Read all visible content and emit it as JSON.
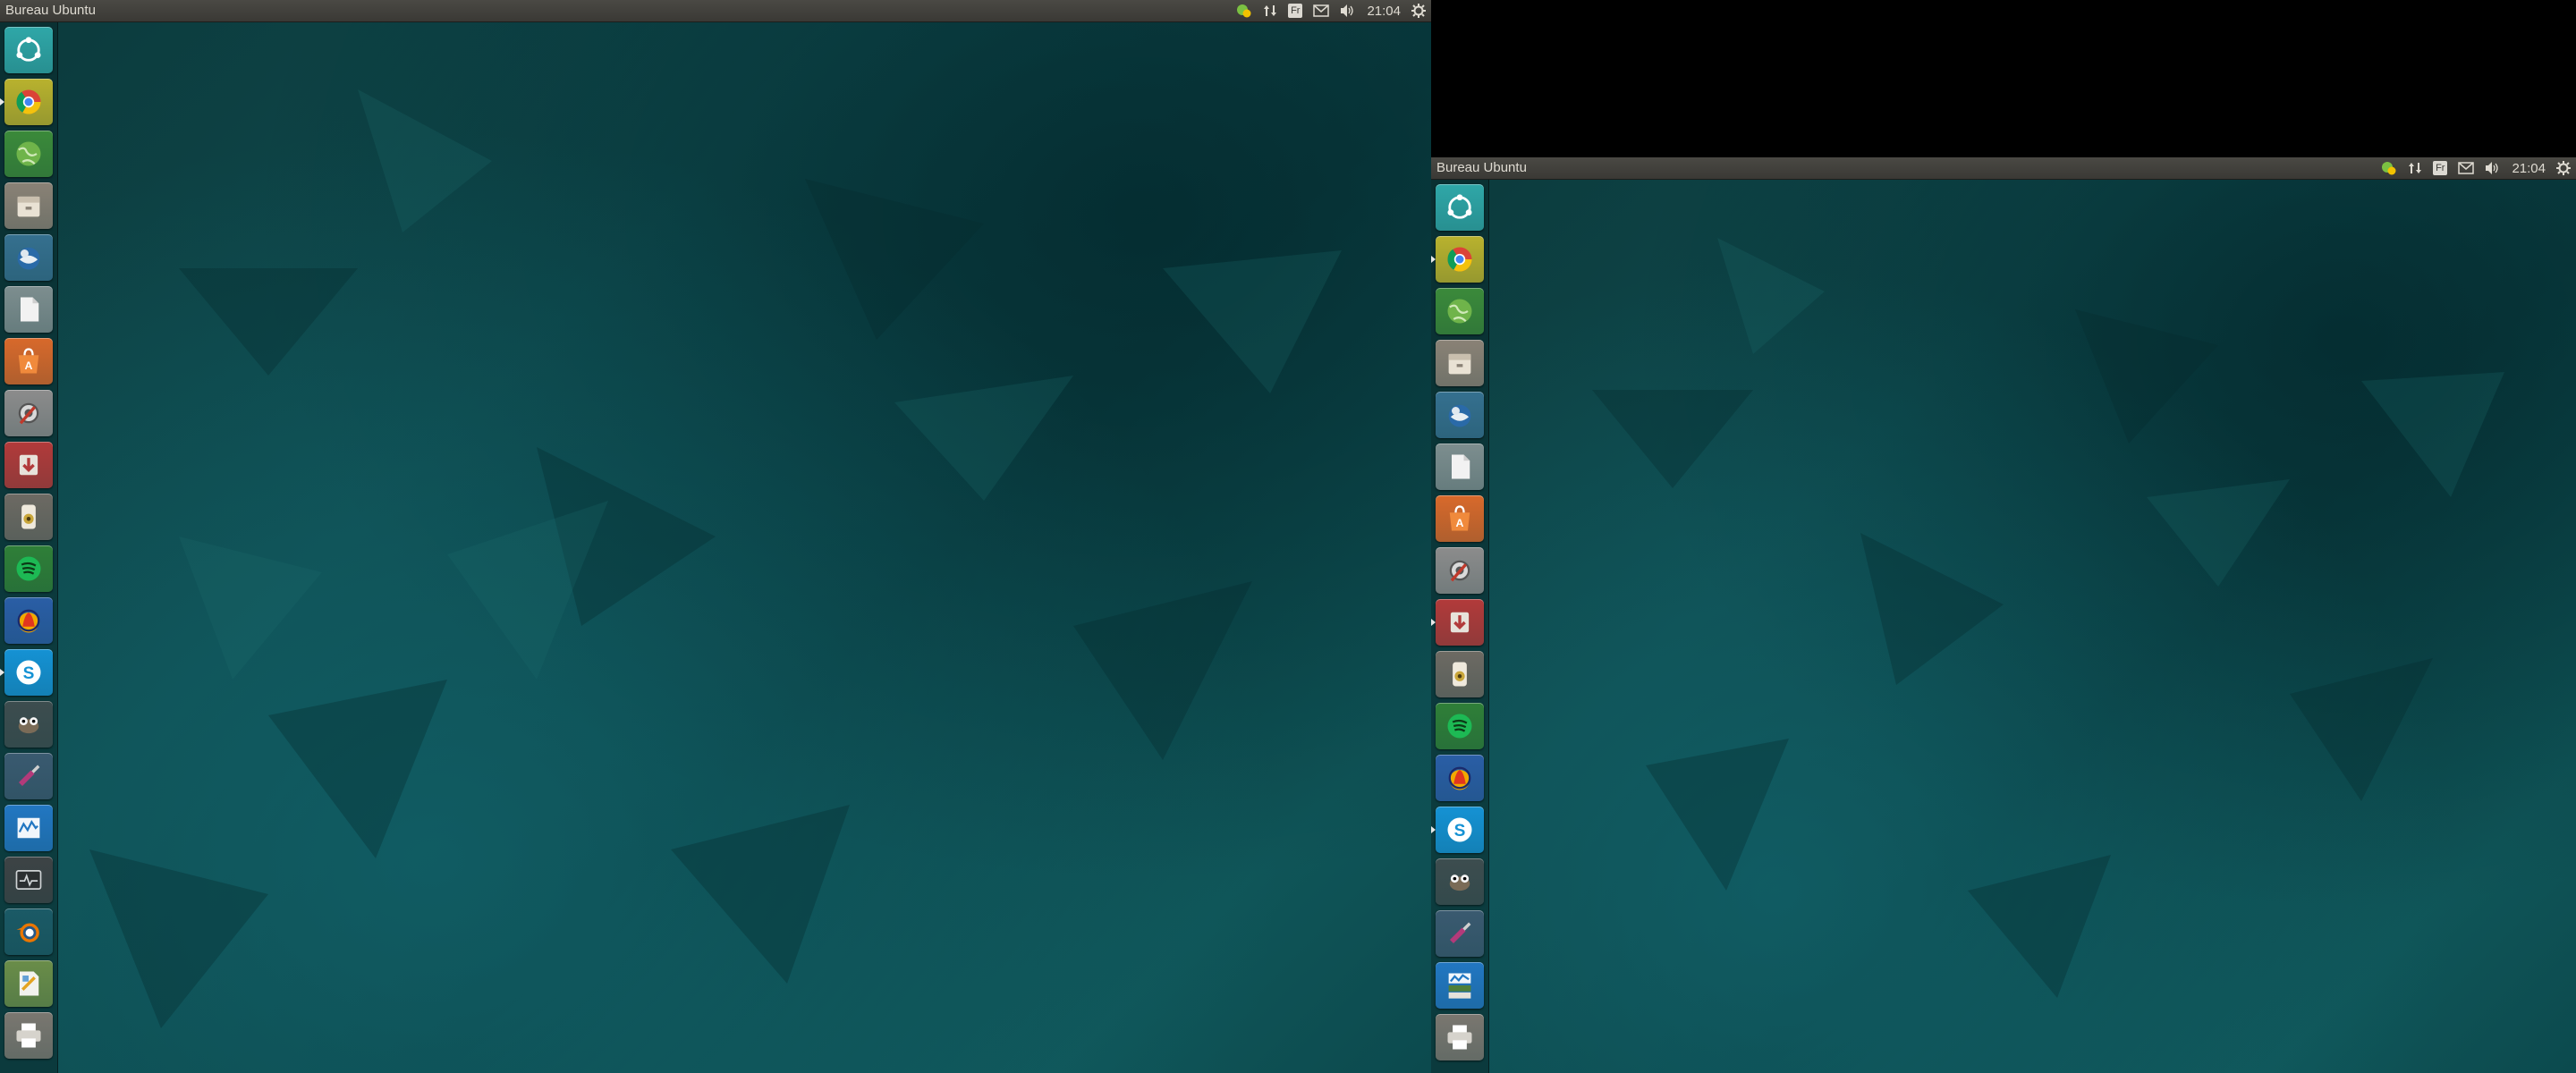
{
  "screens": [
    {
      "panel_title": "Bureau Ubuntu",
      "keyboard_layout": "Fr",
      "clock": "21:04",
      "launcher": [
        {
          "icon": "dash-home-icon",
          "bg": "#2fa7a8"
        },
        {
          "icon": "chrome-icon",
          "bg": "#b9b22e"
        },
        {
          "icon": "network-globe-icon",
          "bg": "#3b8a3a"
        },
        {
          "icon": "file-manager-icon",
          "bg": "#8a8276"
        },
        {
          "icon": "thunderbird-icon",
          "bg": "#35708f"
        },
        {
          "icon": "text-editor-icon",
          "bg": "#7d8e8f"
        },
        {
          "icon": "software-center-icon",
          "bg": "#d8692b"
        },
        {
          "icon": "system-settings-icon",
          "bg": "#8c8c8c"
        },
        {
          "icon": "transmission-icon",
          "bg": "#b23a3a"
        },
        {
          "icon": "speaker-app-icon",
          "bg": "#6d6a63"
        },
        {
          "icon": "spotify-icon",
          "bg": "#2f7f38"
        },
        {
          "icon": "audacity-icon",
          "bg": "#2a5ea6"
        },
        {
          "icon": "skype-icon",
          "bg": "#1592d4"
        },
        {
          "icon": "gimp-icon",
          "bg": "#3d4d4f"
        },
        {
          "icon": "screwdriver-tool-icon",
          "bg": "#3a5a70"
        },
        {
          "icon": "system-monitor-icon",
          "bg": "#2277c2"
        },
        {
          "icon": "terminal-monitor-icon",
          "bg": "#3d4345"
        },
        {
          "icon": "blender-icon",
          "bg": "#1b5a66"
        },
        {
          "icon": "libreoffice-draw-icon",
          "bg": "#6a8d49"
        },
        {
          "icon": "printer-icon",
          "bg": "#7a7770"
        }
      ]
    },
    {
      "panel_title": "Bureau Ubuntu",
      "keyboard_layout": "Fr",
      "clock": "21:04",
      "launcher": [
        {
          "icon": "dash-home-icon",
          "bg": "#2fa7a8"
        },
        {
          "icon": "chrome-icon",
          "bg": "#b9b22e"
        },
        {
          "icon": "network-globe-icon",
          "bg": "#3b8a3a"
        },
        {
          "icon": "file-manager-icon",
          "bg": "#8a8276"
        },
        {
          "icon": "thunderbird-icon",
          "bg": "#35708f"
        },
        {
          "icon": "text-editor-icon",
          "bg": "#7d8e8f"
        },
        {
          "icon": "software-center-icon",
          "bg": "#d8692b"
        },
        {
          "icon": "system-settings-icon",
          "bg": "#8c8c8c"
        },
        {
          "icon": "transmission-icon",
          "bg": "#b23a3a"
        },
        {
          "icon": "speaker-app-icon",
          "bg": "#6d6a63"
        },
        {
          "icon": "spotify-icon",
          "bg": "#2f7f38"
        },
        {
          "icon": "audacity-icon",
          "bg": "#2a5ea6"
        },
        {
          "icon": "skype-icon",
          "bg": "#1592d4"
        },
        {
          "icon": "gimp-icon",
          "bg": "#3d4d4f"
        },
        {
          "icon": "screwdriver-tool-icon",
          "bg": "#3a5a70"
        },
        {
          "icon": "stacked-apps-icon",
          "bg": "#2277c2"
        },
        {
          "icon": "printer-icon",
          "bg": "#7a7770"
        }
      ]
    }
  ]
}
